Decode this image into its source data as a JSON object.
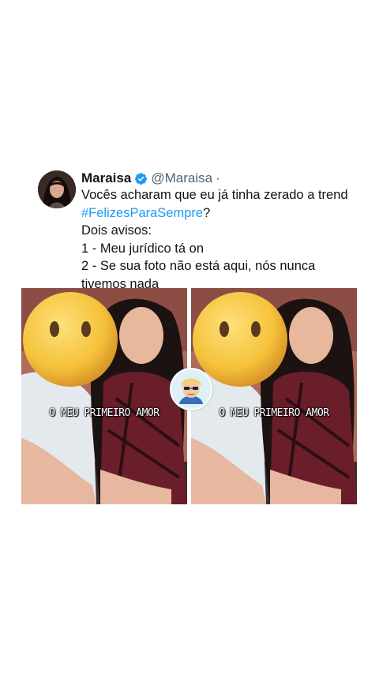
{
  "tweet": {
    "name": "Maraisa",
    "handle": "@Maraisa",
    "separator": "·",
    "lines": [
      "Vocês acharam que eu já tinha zerado a trend",
      "Dois avisos:",
      "1 - Meu jurídico tá on",
      "2 - Se sua foto não está aqui, nós nunca",
      "tivemos nada"
    ],
    "hashtag": "#FelizesParaSempre",
    "hashtag_suffix": "?",
    "verified_icon": "verified-badge-icon"
  },
  "media": {
    "photos": [
      {
        "caption": "O MEU PRIMEIRO AMOR",
        "sticker": "neutral-face-emoji"
      },
      {
        "caption": "O MEU PRIMEIRO AMOR",
        "sticker": "neutral-face-emoji"
      }
    ],
    "center_badge": "cartoon-avatar-icon"
  },
  "colors": {
    "link": "#1d9bf0",
    "text": "#0f1419",
    "secondary": "#536471",
    "emoji": "#f5c23a",
    "background": "#ffffff"
  }
}
